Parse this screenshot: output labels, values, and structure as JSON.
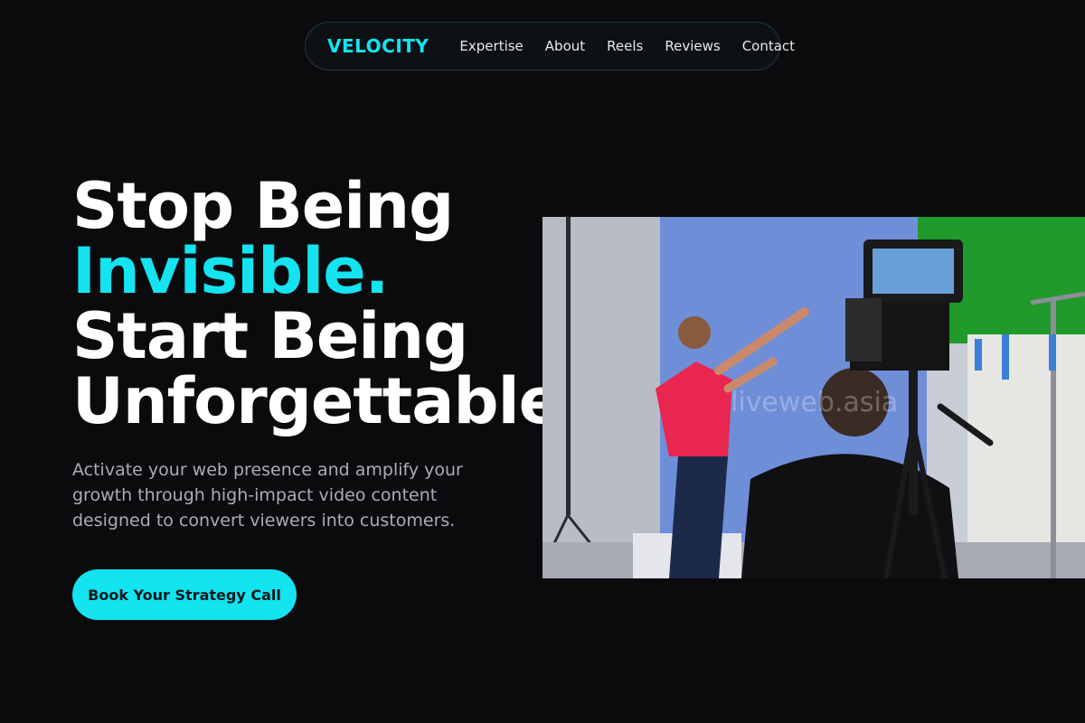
{
  "nav": {
    "brand": "VELOCITY",
    "links": [
      "Expertise",
      "About",
      "Reels",
      "Reviews",
      "Contact"
    ]
  },
  "hero": {
    "headline": {
      "line1": "Stop Being",
      "line2": "Invisible.",
      "line3": "Start Being",
      "line4": "Unforgettable."
    },
    "subtext": "Activate your web presence and amplify your growth through high-impact video content designed to convert viewers into customers.",
    "cta_label": "Book Your Strategy Call",
    "image_watermark": "liveweb.asia"
  },
  "colors": {
    "accent": "#14e3f0",
    "background": "#0b0b0e",
    "text_muted": "#a9adb6"
  }
}
